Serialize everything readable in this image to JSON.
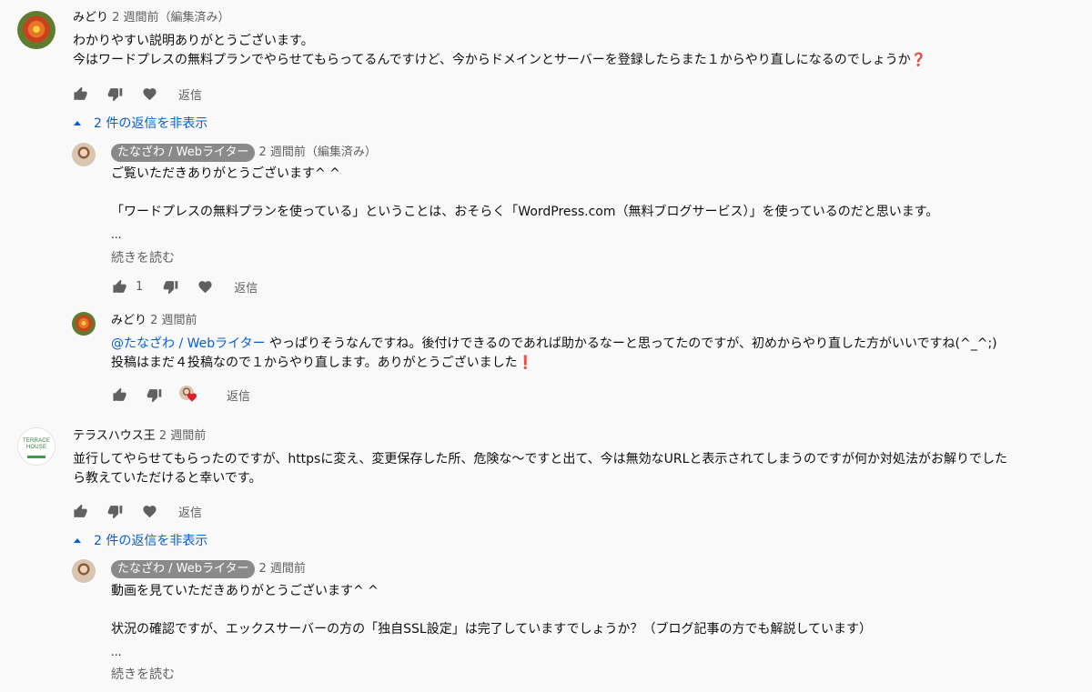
{
  "comments": [
    {
      "author": "みどり",
      "time": "2 週間前（編集済み）",
      "lines": [
        "わかりやすい説明ありがとうございます。",
        "今はワードプレスの無料プランでやらせてもらってるんですけど、今からドメインとサーバーを登録したらまた１からやり直しになるのでしょうか"
      ],
      "line_suffix": "❓",
      "reply_label": "返信",
      "toggle_label": "2 件の返信を非表示",
      "replies": [
        {
          "author": "たなざわ / Webライター",
          "time": "2 週間前（編集済み）",
          "lines": [
            "ご覧いただきありがとうございます^ ^",
            "",
            "「ワードプレスの無料プランを使っている」ということは、おそらく「WordPress.com（無料ブログサービス）」を使っているのだと思います。"
          ],
          "ellipsis": "...",
          "read_more": "続きを読む",
          "like_count": "1",
          "reply_label": "返信"
        },
        {
          "author": "みどり",
          "time": "2 週間前",
          "mention": "@たなざわ / Webライター",
          "line1_rest": " やっぱりそうなんですね。後付けできるのであれば助かるなーと思ってたのですが、初めからやり直した方がいいですね(^_^;)",
          "line2": "投稿はまだ４投稿なので１からやり直します。ありがとうございました",
          "line2_suffix": "❗",
          "reply_label": "返信"
        }
      ]
    },
    {
      "author": "テラスハウス王",
      "time": "2 週間前",
      "avatar_text": [
        "TERRACE",
        "HOUSE"
      ],
      "lines": [
        "並行してやらせてもらったのですが、httpsに変え、変更保存した所、危険な〜ですと出て、今は無効なURLと表示されてしまうのですが何か対処法がお解りでした",
        "ら教えていただけると幸いです。"
      ],
      "reply_label": "返信",
      "toggle_label": "2 件の返信を非表示",
      "replies": [
        {
          "author": "たなざわ / Webライター",
          "time": "2 週間前",
          "lines": [
            "動画を見ていただきありがとうございます^ ^",
            "",
            "状況の確認ですが、エックスサーバーの方の「独自SSL設定」は完了していますでしょうか？（ブログ記事の方でも解説しています）"
          ],
          "ellipsis": "...",
          "read_more": "続きを読む"
        }
      ]
    }
  ],
  "icons": {
    "like": "thumb-up-icon",
    "dislike": "thumb-down-icon",
    "heart": "heart-icon",
    "collapse": "caret-up-icon"
  },
  "colors": {
    "link": "#065fd4",
    "secondary_text": "#606060",
    "heart": "#e11d2a"
  }
}
